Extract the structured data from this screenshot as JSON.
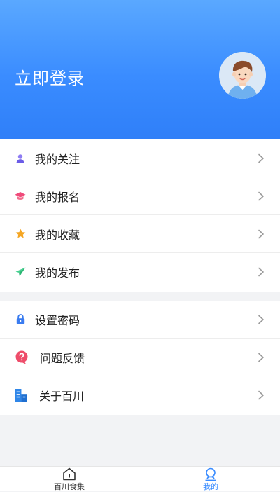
{
  "header": {
    "login_label": "立即登录"
  },
  "menu_group1": [
    {
      "label": "我的关注",
      "icon": "user-icon",
      "color": "#7a6cf0"
    },
    {
      "label": "我的报名",
      "icon": "graduation-cap-icon",
      "color": "#f04a7a"
    },
    {
      "label": "我的收藏",
      "icon": "star-icon",
      "color": "#f5a623"
    },
    {
      "label": "我的发布",
      "icon": "send-icon",
      "color": "#2ec27e"
    }
  ],
  "menu_group2": [
    {
      "label": "设置密码",
      "icon": "lock-icon",
      "color": "#3a7cf0"
    },
    {
      "label": "问题反馈",
      "icon": "question-icon",
      "color": "#ee4d6a"
    },
    {
      "label": "关于百川",
      "icon": "building-icon",
      "color": "#2f86e8"
    }
  ],
  "tabbar": {
    "home_label": "百川食集",
    "mine_label": "我的"
  },
  "colors": {
    "accent": "#3a8cff",
    "header_top": "#5aa8ff",
    "header_bottom": "#2f7ff8"
  }
}
